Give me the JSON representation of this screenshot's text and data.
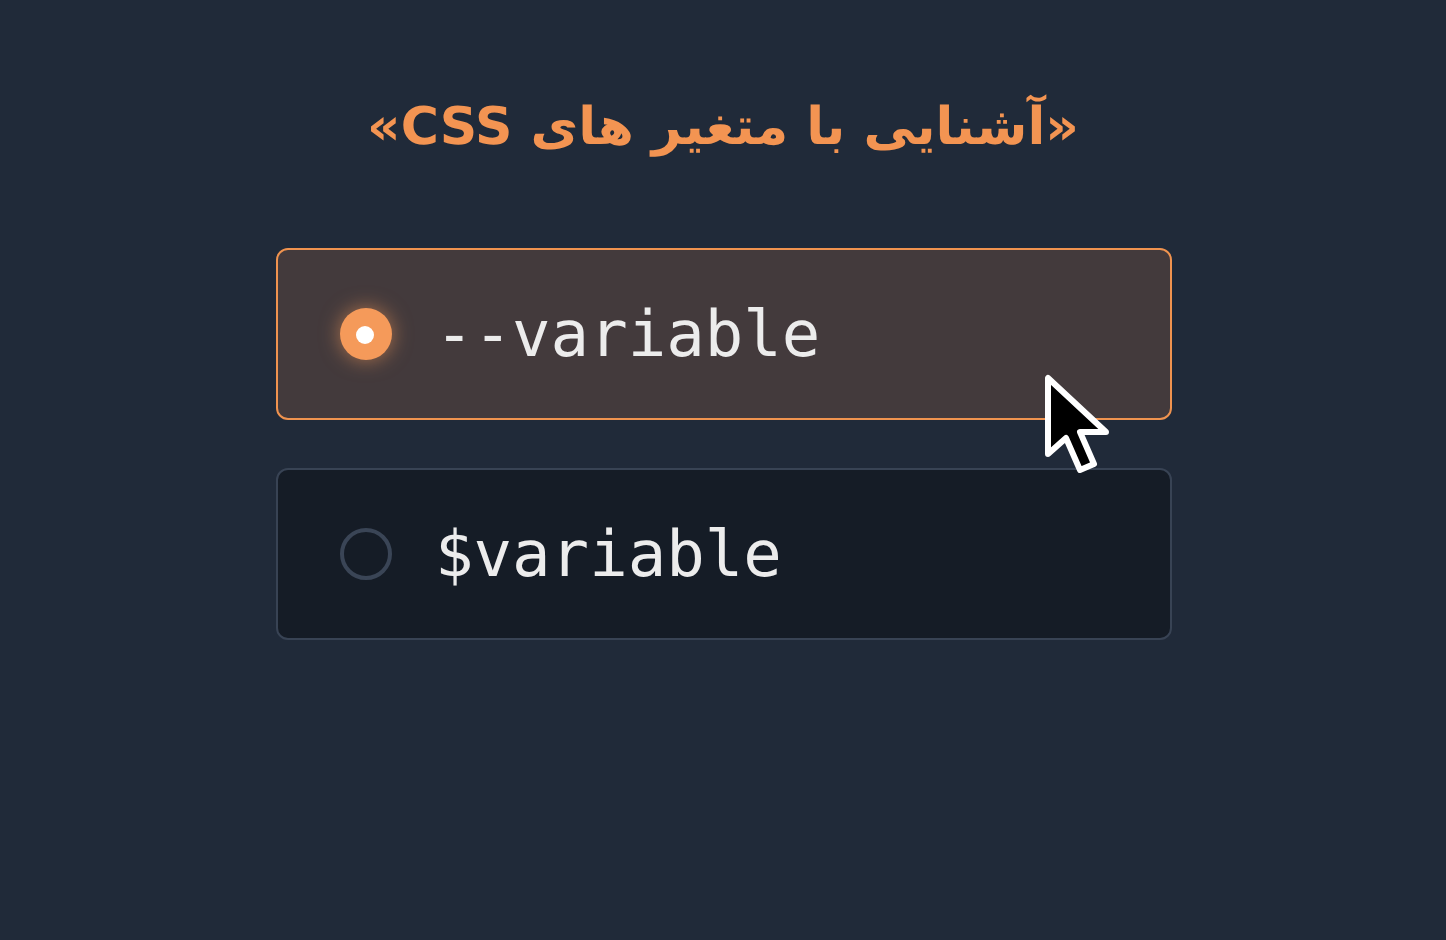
{
  "title": "«آشنایی با متغیر های CSS»",
  "options": [
    {
      "label": "--variable",
      "selected": true
    },
    {
      "label": "$variable",
      "selected": false
    }
  ]
}
